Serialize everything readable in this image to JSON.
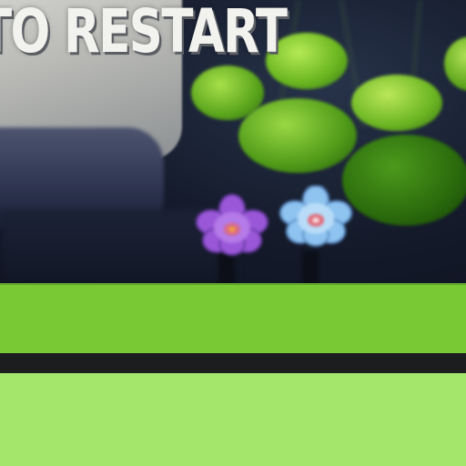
{
  "overlay": {
    "prompt_text": "TO RESTART"
  },
  "colors": {
    "ground_top": "#79c934",
    "ground_divider": "#1b1d1f",
    "ground_bottom": "#a3e66b",
    "prompt_text": "#f2f2ef",
    "flower_purple": "#9a58d8",
    "flower_blue": "#8fc3f0"
  },
  "icons": {
    "flower_purple": "water-lily-purple-icon",
    "flower_blue": "water-lily-blue-icon"
  }
}
